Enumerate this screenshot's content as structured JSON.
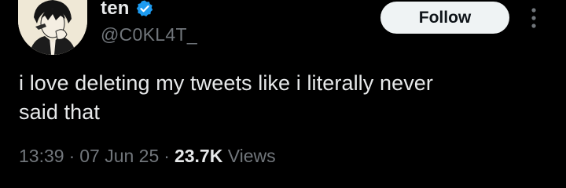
{
  "author": {
    "display_name": "ten",
    "handle": "@C0KL4T_",
    "verified": true
  },
  "actions": {
    "follow_label": "Follow",
    "more_icon": "more-vertical-icon"
  },
  "tweet": {
    "text": "i love deleting my tweets like i literally never\nsaid that",
    "time": "13:39",
    "date": "07 Jun 25",
    "separator": "·",
    "views_count": "23.7K",
    "views_label": "Views"
  },
  "colors": {
    "background": "#000000",
    "text_primary": "#e7e9ea",
    "text_secondary": "#71767b",
    "follow_bg": "#eff3f4",
    "follow_text": "#0f1419",
    "verified": "#1d9bf0"
  }
}
